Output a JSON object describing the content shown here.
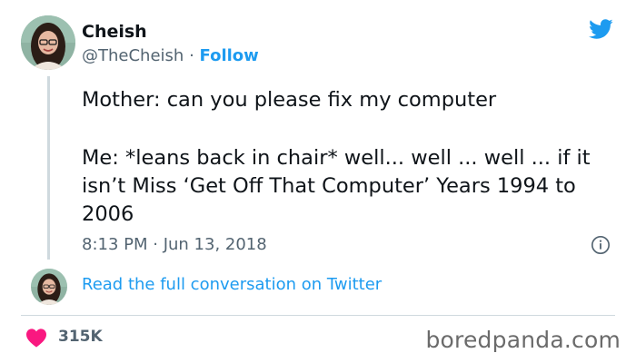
{
  "tweet": {
    "author_name": "Cheish",
    "author_handle": "@TheCheish",
    "separator": "·",
    "follow_label": "Follow",
    "text_line_1": "Mother: can you please fix my computer",
    "text_line_2": "Me: *leans back in chair* well... well ... well ... if it isn’t Miss ‘Get Off That Computer’ Years 1994 to 2006",
    "timestamp": "8:13 PM · Jun 13, 2018",
    "read_full_label": "Read the full conversation on Twitter",
    "likes_count": "315K"
  },
  "watermark": "boredpanda.com",
  "icons": {
    "brand": "twitter-bird-icon",
    "info": "info-icon",
    "like": "heart-icon"
  },
  "colors": {
    "accent": "#1d9bf0",
    "heart": "#f91880",
    "muted_text": "#536471",
    "text": "#0f1419",
    "divider": "#cfd9de"
  }
}
